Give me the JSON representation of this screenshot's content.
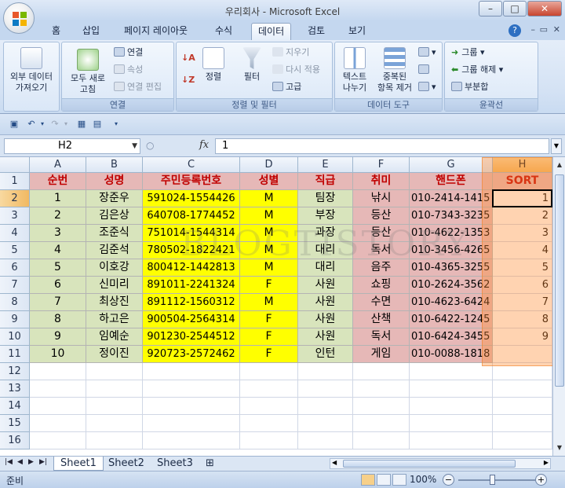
{
  "window": {
    "title": "우리회사 - Microsoft Excel",
    "controls": [
      "–",
      "□",
      "✕"
    ]
  },
  "ribbon_tabs": [
    "홈",
    "삽입",
    "페이지 레이아웃",
    "수식",
    "데이터",
    "검토",
    "보기"
  ],
  "active_tab": "데이터",
  "ribbon": {
    "external": {
      "label": "외부 데이터\n가져오기"
    },
    "connections": {
      "refresh_label": "모두 새로\n고침",
      "connect": "연결",
      "properties": "속성",
      "edit_links": "연결 편집",
      "group_label": "연결"
    },
    "sort_filter": {
      "sort": "정렬",
      "filter": "필터",
      "clear": "지우기",
      "reapply": "다시 적용",
      "advanced": "고급",
      "group_label": "정렬 및 필터"
    },
    "data_tools": {
      "text_to_columns": "텍스트\n나누기",
      "remove_duplicates": "중복된\n항목 제거",
      "group_label": "데이터 도구"
    },
    "outline": {
      "group": "그룹",
      "ungroup": "그룹 해제",
      "subtotal": "부분합",
      "group_label": "윤곽선"
    }
  },
  "formula_bar": {
    "name_box": "H2",
    "fx": "fx",
    "value": "1"
  },
  "columns": [
    "A",
    "B",
    "C",
    "D",
    "E",
    "F",
    "G",
    "H"
  ],
  "selected_column": "H",
  "selected_row": 2,
  "row_numbers": [
    1,
    2,
    3,
    4,
    5,
    6,
    7,
    8,
    9,
    10,
    11,
    12,
    13,
    14,
    15,
    16
  ],
  "table": {
    "headers": [
      "순번",
      "성명",
      "주민등록번호",
      "성별",
      "직급",
      "취미",
      "핸드폰",
      "SORT"
    ],
    "rows": [
      [
        "1",
        "장준우",
        "591024-1554426",
        "M",
        "팀장",
        "낚시",
        "010-2414-1415",
        "1"
      ],
      [
        "2",
        "김은상",
        "640708-1774452",
        "M",
        "부장",
        "등산",
        "010-7343-3235",
        "2"
      ],
      [
        "3",
        "조준식",
        "751014-1544314",
        "M",
        "과장",
        "등산",
        "010-4622-1353",
        "3"
      ],
      [
        "4",
        "김준석",
        "780502-1822421",
        "M",
        "대리",
        "독서",
        "010-3456-4265",
        "4"
      ],
      [
        "5",
        "이호강",
        "800412-1442813",
        "M",
        "대리",
        "음주",
        "010-4365-3255",
        "5"
      ],
      [
        "6",
        "신미리",
        "891011-2241324",
        "F",
        "사원",
        "쇼핑",
        "010-2624-3562",
        "6"
      ],
      [
        "7",
        "최상진",
        "891112-1560312",
        "M",
        "사원",
        "수면",
        "010-4623-6424",
        "7"
      ],
      [
        "8",
        "하고은",
        "900504-2564314",
        "F",
        "사원",
        "산책",
        "010-6422-1245",
        "8"
      ],
      [
        "9",
        "임예순",
        "901230-2544512",
        "F",
        "사원",
        "독서",
        "010-6424-3455",
        "9"
      ],
      [
        "10",
        "정이진",
        "920723-2572462",
        "F",
        "인턴",
        "게임",
        "010-0088-1818",
        ""
      ]
    ]
  },
  "colors": {
    "header_bg": "#e6b8b7",
    "green_bg": "#d8e4bc",
    "yellow_bg": "#ffff00",
    "pink_bg": "#e6b8b7",
    "sort_highlight": "#f79646"
  },
  "watermark": "BLOGTISTORY",
  "sheets": [
    "Sheet1",
    "Sheet2",
    "Sheet3"
  ],
  "active_sheet": "Sheet1",
  "status": {
    "ready": "준비",
    "zoom": "100%"
  }
}
